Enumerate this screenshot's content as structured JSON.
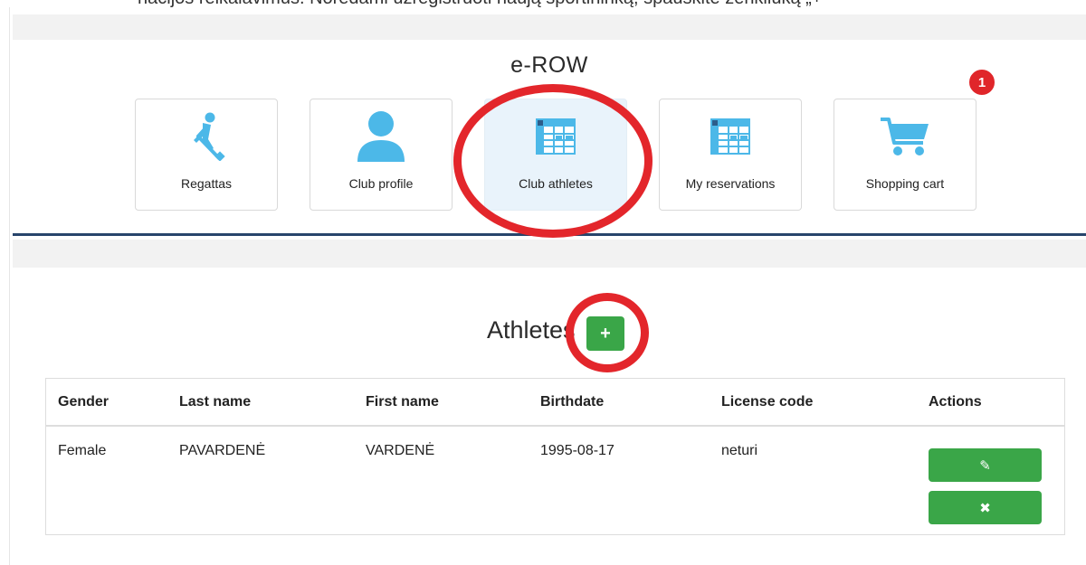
{
  "app": {
    "title": "e-ROW"
  },
  "top_clip_text": "nacijos reikalavimus. Norėdami užregistruoti naują sportininką, spauskite ženkliuką „+“",
  "nav": {
    "tiles": [
      {
        "label": "Regattas",
        "icon": "rower-icon",
        "active": false
      },
      {
        "label": "Club profile",
        "icon": "user-icon",
        "active": false
      },
      {
        "label": "Club athletes",
        "icon": "table-icon",
        "active": true
      },
      {
        "label": "My reservations",
        "icon": "table-icon",
        "active": false
      },
      {
        "label": "Shopping cart",
        "icon": "cart-icon",
        "active": false
      }
    ],
    "cart_badge": "1"
  },
  "athletes": {
    "title": "Athletes",
    "add_label": "+",
    "columns": [
      "Gender",
      "Last name",
      "First name",
      "Birthdate",
      "License code",
      "Actions"
    ],
    "rows": [
      {
        "gender": "Female",
        "last_name": "PAVARDENĖ",
        "first_name": "VARDENĖ",
        "birthdate": "1995-08-17",
        "license_code": "neturi",
        "edit_label": "✎",
        "delete_label": "✖"
      }
    ]
  },
  "colors": {
    "accent_blue": "#4cb8e8",
    "action_green": "#3aa648",
    "annotation_red": "#e3262b",
    "header_rule": "#27456b",
    "badge_red": "#e0262a"
  }
}
